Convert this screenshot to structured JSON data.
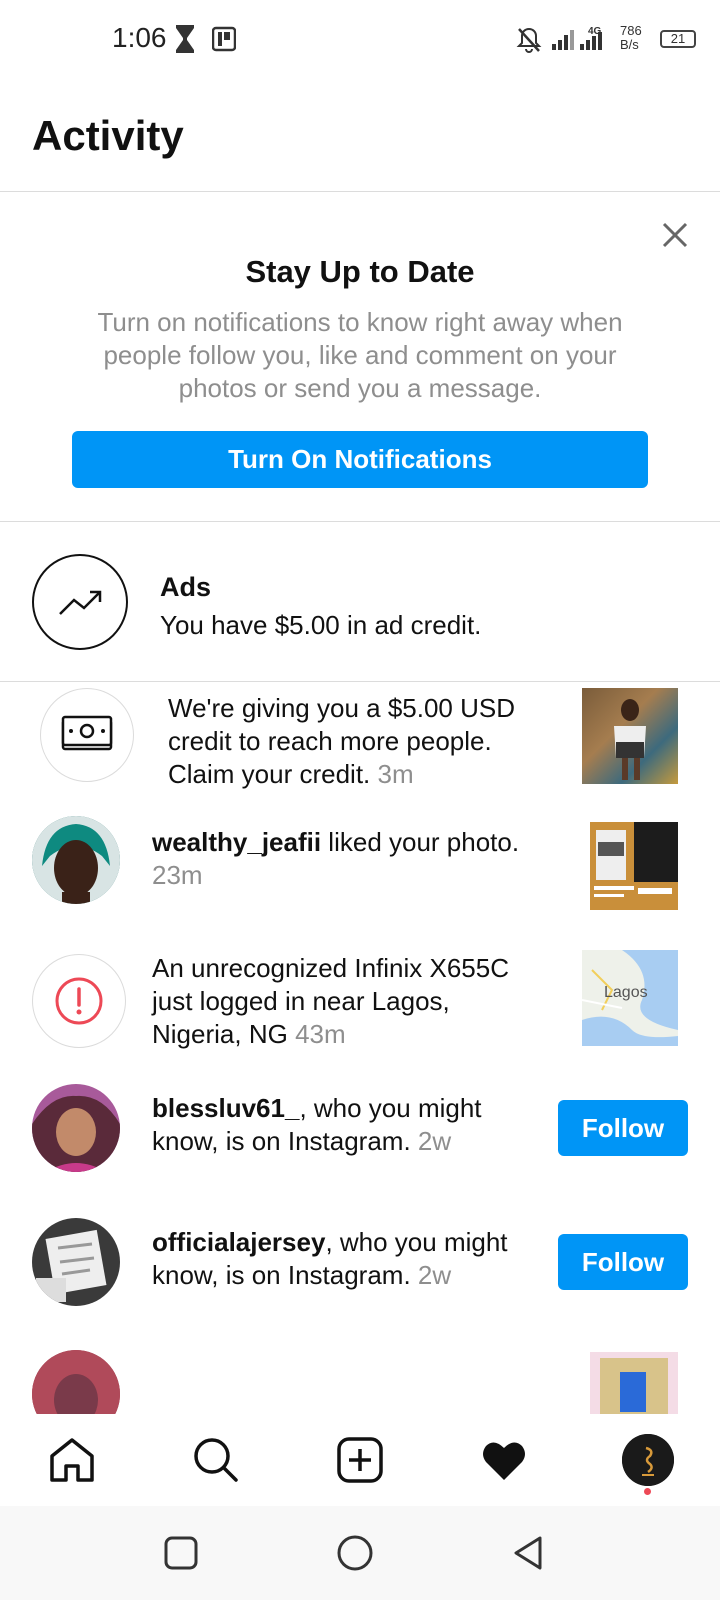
{
  "status_bar": {
    "time": "1:06",
    "speed_value": "786",
    "speed_unit": "B/s",
    "battery": "21",
    "icons": [
      "hourglass-icon",
      "app-notification-icon",
      "bell-muted-icon",
      "signal-icon",
      "signal-4g-icon",
      "battery-icon"
    ]
  },
  "header": {
    "title": "Activity"
  },
  "prompt": {
    "title": "Stay Up to Date",
    "description": "Turn on notifications to know right away when people follow you, like and comment on your photos or send you a message.",
    "button_label": "Turn On Notifications",
    "close_icon": "close-icon"
  },
  "ads": {
    "title": "Ads",
    "subtitle": "You have $5.00 in ad credit.",
    "icon": "trending-up-icon"
  },
  "activity": [
    {
      "text": "We're giving you a $5.00 USD credit to reach more people. Claim your credit.",
      "time": "3m",
      "icon": "money-icon"
    },
    {
      "username": "wealthy_jeafii",
      "text": " liked your photo.",
      "time": "23m"
    },
    {
      "text": "An unrecognized Infinix X655C just logged in near Lagos, Nigeria, NG",
      "time": "43m",
      "icon": "alert-icon",
      "map_label": "Lagos"
    },
    {
      "username": "blessluv61_",
      "text": ", who you might know, is on Instagram.",
      "time": "2w",
      "button_label": "Follow"
    },
    {
      "username": "officialajersey",
      "text": ", who you might know, is on Instagram.",
      "time": "2w",
      "button_label": "Follow"
    }
  ],
  "bottom_nav": {
    "icons": [
      "home-icon",
      "search-icon",
      "add-post-icon",
      "heart-icon",
      "profile-avatar"
    ]
  },
  "colors": {
    "accent": "#0095f6",
    "secondary_text": "#8e8e8e",
    "notification_dot": "#ed4956"
  }
}
